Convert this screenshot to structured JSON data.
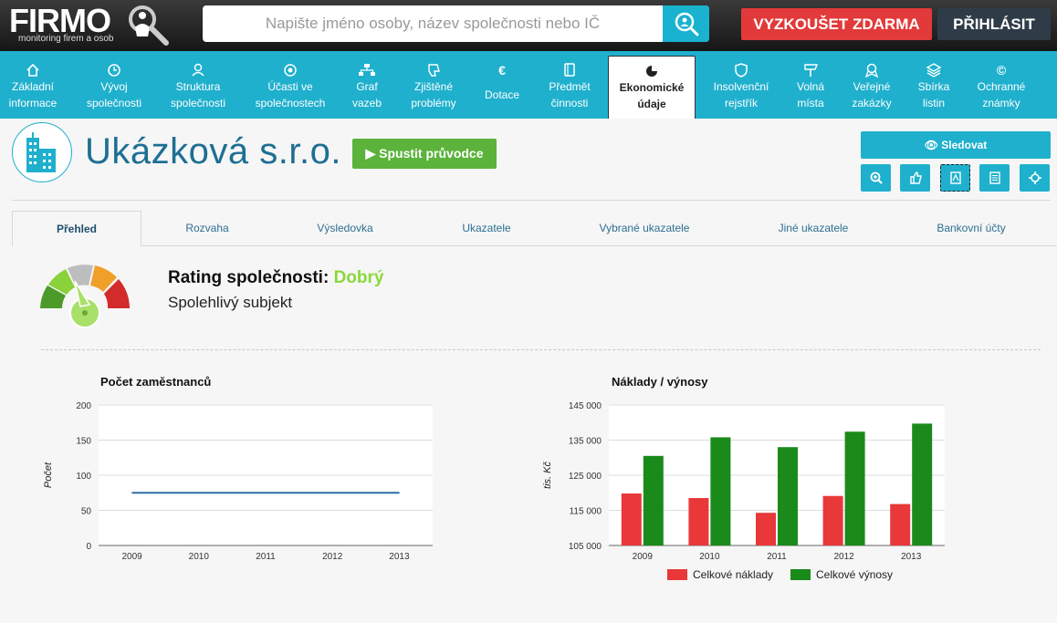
{
  "brand": {
    "name": "FIRMO",
    "tagline": "monitoring firem a osob"
  },
  "search": {
    "placeholder": "Napište jméno osoby, název společnosti nebo IČ",
    "value": ""
  },
  "header_buttons": {
    "try_free": "VYZKOUŠET ZDARMA",
    "login": "PŘIHLÁSIT"
  },
  "nav": {
    "items": [
      {
        "l1": "Základní",
        "l2": "informace",
        "icon": "home-icon"
      },
      {
        "l1": "Vývoj",
        "l2": "společnosti",
        "icon": "clock-icon"
      },
      {
        "l1": "Struktura",
        "l2": "společnosti",
        "icon": "users-icon"
      },
      {
        "l1": "Účasti ve",
        "l2": "společnostech",
        "icon": "target-icon"
      },
      {
        "l1": "Graf",
        "l2": "vazeb",
        "icon": "sitemap-icon"
      },
      {
        "l1": "Zjištěné",
        "l2": "problémy",
        "icon": "thumbs-down-icon"
      },
      {
        "l1": "Dotace",
        "l2": "",
        "icon": "euro-icon"
      },
      {
        "l1": "Předmět",
        "l2": "činnosti",
        "icon": "book-icon"
      },
      {
        "l1": "Ekonomické",
        "l2": "údaje",
        "icon": "pie-chart-icon"
      },
      {
        "l1": "Insolvenční",
        "l2": "rejstřík",
        "icon": "shield-icon"
      },
      {
        "l1": "Volná",
        "l2": "místa",
        "icon": "signpost-icon"
      },
      {
        "l1": "Veřejné",
        "l2": "zakázky",
        "icon": "award-icon"
      },
      {
        "l1": "Sbírka",
        "l2": "listin",
        "icon": "layers-icon"
      },
      {
        "l1": "Ochranné",
        "l2": "známky",
        "icon": "copyright-icon"
      }
    ],
    "active_index": 8
  },
  "company": {
    "name": "Ukázková s.r.o.",
    "guide_button": "Spustit průvodce",
    "follow_button": "Sledovat"
  },
  "tabs": [
    "Přehled",
    "Rozvaha",
    "Výsledovka",
    "Ukazatele",
    "Vybrané ukazatele",
    "Jiné ukazatele",
    "Bankovní účty"
  ],
  "active_tab": 0,
  "rating": {
    "label": "Rating společnosti:",
    "value": "Dobrý",
    "description": "Spolehlivý subjekt",
    "value_color": "#8bd83a"
  },
  "chart_data": [
    {
      "type": "line",
      "title": "Počet zaměstnanců",
      "ylabel": "Počet",
      "xlabel": "",
      "categories": [
        "2009",
        "2010",
        "2011",
        "2012",
        "2013"
      ],
      "series": [
        {
          "values": [
            75,
            75,
            75,
            75,
            75
          ],
          "color": "#2e6ea6"
        }
      ],
      "ylim": [
        0,
        200
      ],
      "yticks": [
        "0",
        "50",
        "100",
        "150",
        "200"
      ],
      "grid": true
    },
    {
      "type": "bar",
      "title": "Náklady / výnosy",
      "ylabel": "tis. Kč",
      "xlabel": "",
      "categories": [
        "2009",
        "2010",
        "2011",
        "2012",
        "2013"
      ],
      "series": [
        {
          "name": "Celkové náklady",
          "values": [
            119800,
            118500,
            114300,
            119100,
            116800
          ],
          "color": "#e8383a"
        },
        {
          "name": "Celkové výnosy",
          "values": [
            130500,
            135800,
            133000,
            137400,
            139700
          ],
          "color": "#1a8a1a"
        }
      ],
      "ylim": [
        105000,
        145000
      ],
      "yticks": [
        "105 000",
        "115 000",
        "125 000",
        "135 000",
        "145 000"
      ],
      "legend": "bottom",
      "grid": true
    }
  ]
}
